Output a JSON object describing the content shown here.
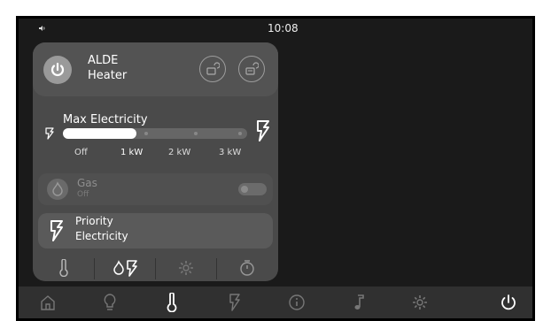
{
  "status": {
    "time": "10:08"
  },
  "heater": {
    "brand": "ALDE",
    "name": "Heater"
  },
  "electricity": {
    "title": "Max Electricity",
    "options": [
      "Off",
      "1 kW",
      "2 kW",
      "3 kW"
    ],
    "selected_level_fraction": 0.4
  },
  "gas": {
    "label": "Gas",
    "state": "Off"
  },
  "priority": {
    "line1": "Priority",
    "line2": "Electricity"
  },
  "tabs": [
    "thermometer-icon",
    "gas-electricity-icon",
    "settings-icon",
    "timer-icon"
  ],
  "navbar": [
    "home-icon",
    "light-icon",
    "thermometer-icon",
    "electricity-icon",
    "info-icon",
    "music-icon",
    "settings-icon",
    "power-icon"
  ],
  "colors": {
    "panel": "#4a4a4a",
    "row": "#5a5a5a",
    "background": "#1a1a1a",
    "navbar": "#303030"
  }
}
